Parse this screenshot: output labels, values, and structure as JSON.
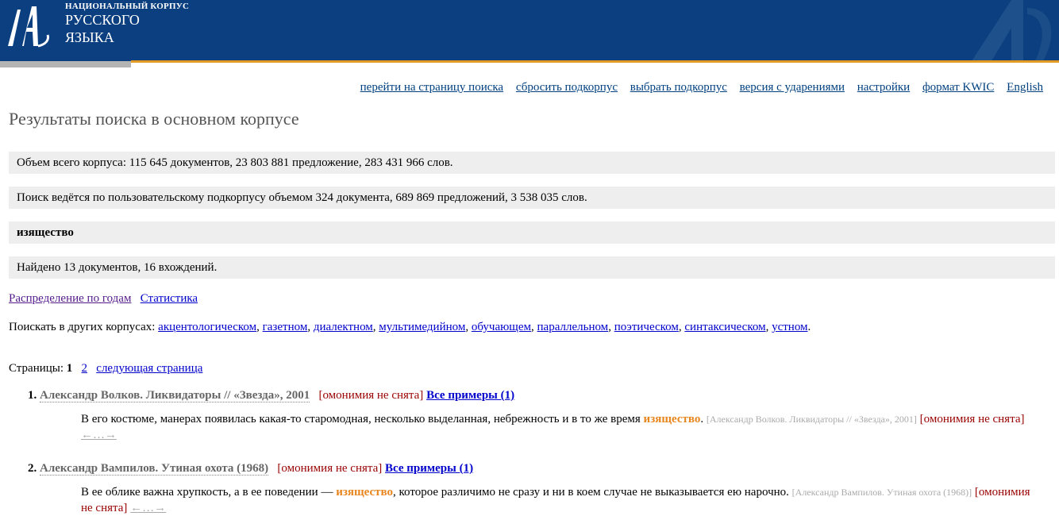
{
  "header": {
    "logo_line1": "НАЦИОНАЛЬНЫЙ КОРПУС",
    "logo_line2": "РУССКОГО",
    "logo_line3": "ЯЗЫКА"
  },
  "topnav": [
    "перейти на страницу поиска",
    "сбросить подкорпус",
    "выбрать подкорпус",
    "версия с ударениями",
    "настройки",
    "формат KWIC",
    "English"
  ],
  "page_title": "Результаты поиска в основном корпусе",
  "stats": {
    "corpus_volume": "Объем всего корпуса: 115 645 документов, 23 803 881 предложение, 283 431 966 слов.",
    "subcorpus": "Поиск ведётся по пользовательскому подкорпусу объемом 324 документа, 689 869 предложений, 3 538 035 слов.",
    "query": "изящество",
    "found": "Найдено 13 документов, 16 вхождений."
  },
  "links": {
    "distribution": "Распределение по годам",
    "statistics": "Статистика"
  },
  "other_corpora": {
    "label": "Поискать в других корпусах:",
    "items": [
      "акцентологическом",
      "газетном",
      "диалектном",
      "мультимедийном",
      "обучающем",
      "параллельном",
      "поэтическом",
      "синтаксическом",
      "устном"
    ]
  },
  "pager": {
    "label": "Страницы:",
    "current": "1",
    "next_num": "2",
    "next_label": "следующая страница"
  },
  "results": [
    {
      "num": "1.",
      "title": "Александр Волков. Ликвидаторы // «Звезда», 2001",
      "homonymy": "[омонимия не снята]",
      "all_examples": "Все примеры (1)",
      "before": "В его костюме, манерах появилась какая-то старомодная, несколько выделанная, небрежность и в то же время ",
      "hit": "изящество",
      "after": ". ",
      "source": "[Александр Волков. Ликвидаторы // «Звезда», 2001]",
      "homonymy2": "[омонимия не снята]",
      "arrows": "←…→"
    },
    {
      "num": "2.",
      "title": "Александр Вампилов. Утиная охота (1968)",
      "homonymy": "[омонимия не снята]",
      "all_examples": "Все примеры (1)",
      "before": "В ее облике важна хрупкость, а в ее поведении — ",
      "hit": "изящество",
      "after": ", которое различимо не сразу и ни в коем случае не выказывается ею нарочно. ",
      "source": "[Александр Вампилов. Утиная охота (1968)]",
      "homonymy2": "[омонимия не снята]",
      "arrows": "←…→"
    }
  ],
  "colors": {
    "header_blue": "#0b3f7f",
    "header_orange": "#e39b24",
    "hit_orange": "#e8861e",
    "homonymy_red": "#990000",
    "link_blue": "#0000cc"
  }
}
